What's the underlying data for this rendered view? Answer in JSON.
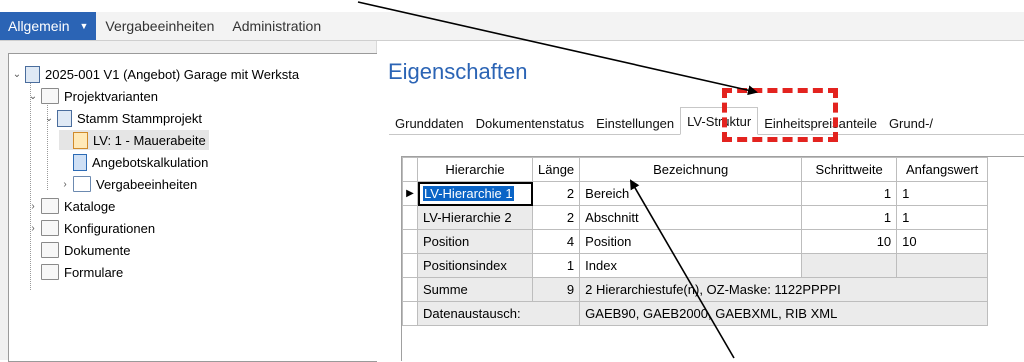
{
  "menu": {
    "active": "Allgemein",
    "items": [
      "Vergabeeinheiten",
      "Administration"
    ]
  },
  "tree": {
    "root": "2025-001 V1 (Angebot) Garage mit Werksta",
    "projektvarianten": "Projektvarianten",
    "stamm": "Stamm Stammprojekt",
    "lv": "LV: 1 - Mauerabeite",
    "angebot": "Angebotskalkulation",
    "vergabe": "Vergabeeinheiten",
    "kataloge": "Kataloge",
    "konfigurationen": "Konfigurationen",
    "dokumente": "Dokumente",
    "formulare": "Formulare"
  },
  "panel": {
    "title": "Eigenschaften",
    "tabs": [
      "Grunddaten",
      "Dokumentenstatus",
      "Einstellungen",
      "LV-Struktur",
      "Einheitspreisanteile",
      "Grund-/"
    ]
  },
  "grid": {
    "headers": [
      "Hierarchie",
      "Länge",
      "Bezeichnung",
      "Schrittweite",
      "Anfangswert"
    ],
    "rows": [
      {
        "hier": "LV-Hierarchie 1",
        "len": "2",
        "bez": "Bereich",
        "step": "1",
        "start": "1"
      },
      {
        "hier": "LV-Hierarchie 2",
        "len": "2",
        "bez": "Abschnitt",
        "step": "1",
        "start": "1"
      },
      {
        "hier": "Position",
        "len": "4",
        "bez": "Position",
        "step": "10",
        "start": "10"
      },
      {
        "hier": "Positionsindex",
        "len": "1",
        "bez": "Index",
        "step": "",
        "start": ""
      }
    ],
    "summe": {
      "label": "Summe",
      "len": "9",
      "text": "2 Hierarchiestufe(n), OZ-Maske: 1122PPPPI"
    },
    "datenaustausch": {
      "label": "Datenaustausch:",
      "text": "GAEB90, GAEB2000, GAEBXML, RIB XML"
    }
  },
  "colors": {
    "accent": "#2b64b5",
    "callout": "#e3231f"
  }
}
